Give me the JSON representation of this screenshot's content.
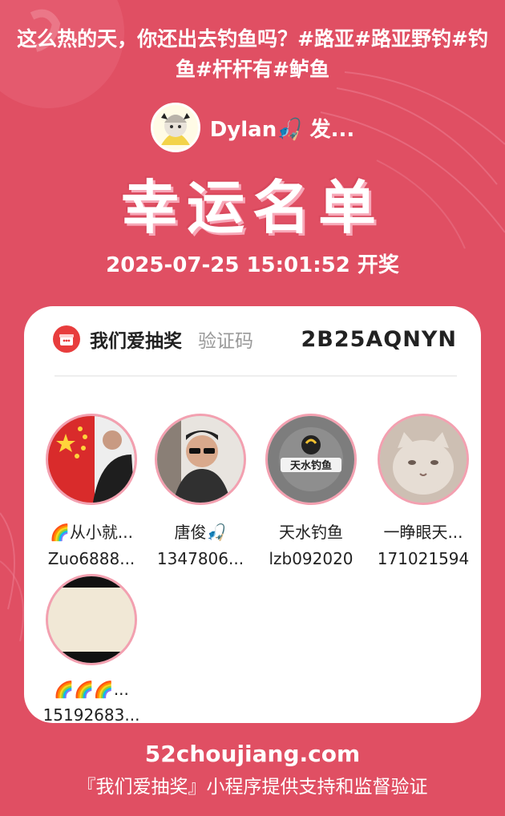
{
  "post": {
    "title": "这么热的天，你还出去钓鱼吗？#路亚#路亚野钓#钓鱼#杆杆有#鲈鱼"
  },
  "creator": {
    "name": "Dylan🎣 发..."
  },
  "lottery": {
    "heading": "幸运名单",
    "draw_time": "2025-07-25 15:01:52 开奖"
  },
  "card": {
    "brand": "我们爱抽奖",
    "verify_label": "验证码",
    "verify_code": "2B25AQNYN"
  },
  "winners": [
    {
      "name": "🌈从小就...",
      "uid": "Zuo6888...",
      "avatar": "flag-portrait"
    },
    {
      "name": "唐俊🎣",
      "uid": "1347806...",
      "avatar": "man-sunglasses"
    },
    {
      "name": "天水钓鱼",
      "uid": "lzb092020",
      "avatar": "fishing-logo"
    },
    {
      "name": "一睁眼天...",
      "uid": "171021594",
      "avatar": "cat-photo"
    },
    {
      "name": "🌈🌈🌈...",
      "uid": "15192683...",
      "avatar": "blank-frame"
    }
  ],
  "footer": {
    "site": "52choujiang.com",
    "note": "『我们爱抽奖』小程序提供支持和监督验证"
  },
  "colors": {
    "background": "#e04f63",
    "card": "#ffffff",
    "avatar_ring": "#f3a0b0",
    "brand_badge": "#e83d3d"
  }
}
